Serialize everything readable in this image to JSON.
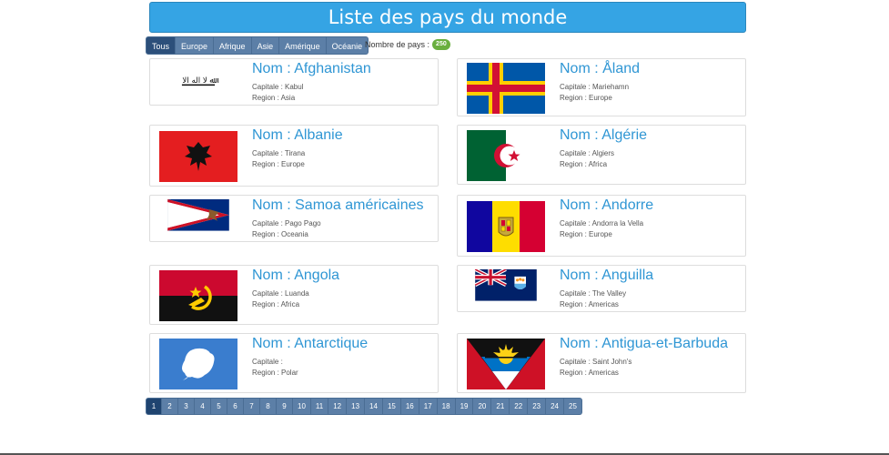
{
  "title": "Liste des pays du monde",
  "filters": [
    "Tous",
    "Europe",
    "Afrique",
    "Asie",
    "Amérique",
    "Océanie"
  ],
  "active_filter": "Tous",
  "count_label": "Nombre de pays :",
  "count_value": "250",
  "countries": [
    {
      "name": "Nom : Afghanistan",
      "capital": "Capitale : Kabul",
      "region": "Region : Asia",
      "flag": "afghanistan-flag"
    },
    {
      "name": "Nom : Åland",
      "capital": "Capitale : Mariehamn",
      "region": "Region : Europe",
      "flag": "aland-flag"
    },
    {
      "name": "Nom : Albanie",
      "capital": "Capitale : Tirana",
      "region": "Region : Europe",
      "flag": "albania-flag"
    },
    {
      "name": "Nom : Algérie",
      "capital": "Capitale : Algiers",
      "region": "Region : Africa",
      "flag": "algeria-flag"
    },
    {
      "name": "Nom : Samoa américaines",
      "capital": "Capitale : Pago Pago",
      "region": "Region : Oceania",
      "flag": "american-samoa-flag"
    },
    {
      "name": "Nom : Andorre",
      "capital": "Capitale : Andorra la Vella",
      "region": "Region : Europe",
      "flag": "andorra-flag"
    },
    {
      "name": "Nom : Angola",
      "capital": "Capitale : Luanda",
      "region": "Region : Africa",
      "flag": "angola-flag"
    },
    {
      "name": "Nom : Anguilla",
      "capital": "Capitale : The Valley",
      "region": "Region : Americas",
      "flag": "anguilla-flag"
    },
    {
      "name": "Nom : Antarctique",
      "capital": "Capitale :",
      "region": "Region : Polar",
      "flag": "antarctica-flag"
    },
    {
      "name": "Nom : Antigua-et-Barbuda",
      "capital": "Capitale : Saint John's",
      "region": "Region : Americas",
      "flag": "antigua-barbuda-flag"
    }
  ],
  "pages": [
    "1",
    "2",
    "3",
    "4",
    "5",
    "6",
    "7",
    "8",
    "9",
    "10",
    "11",
    "12",
    "13",
    "14",
    "15",
    "16",
    "17",
    "18",
    "19",
    "20",
    "21",
    "22",
    "23",
    "24",
    "25"
  ],
  "current_page": "1"
}
